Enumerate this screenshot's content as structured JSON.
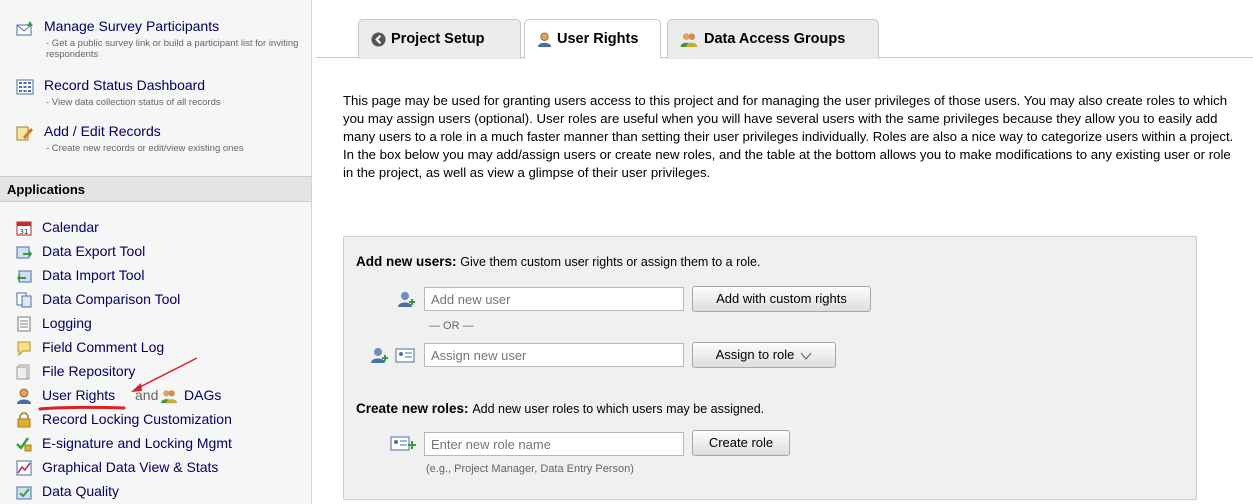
{
  "left_menu": {
    "top_links": [
      {
        "title": "Manage Survey Participants",
        "desc": "- Get a public survey link or build a participant list for inviting respondents",
        "icon": "survey-participants-icon"
      },
      {
        "title": "Record Status Dashboard",
        "desc": "- View data collection status of all records",
        "icon": "dashboard-grid-icon"
      },
      {
        "title": "Add / Edit Records",
        "desc": "- Create new records or edit/view existing ones",
        "icon": "edit-records-icon"
      }
    ],
    "apps_header": "Applications",
    "apps": [
      {
        "label": "Calendar",
        "icon": "calendar-icon"
      },
      {
        "label": "Data Export Tool",
        "icon": "data-export-icon"
      },
      {
        "label": "Data Import Tool",
        "icon": "data-import-icon"
      },
      {
        "label": "Data Comparison Tool",
        "icon": "data-comparison-icon"
      },
      {
        "label": "Logging",
        "icon": "logging-icon"
      },
      {
        "label": "Field Comment Log",
        "icon": "comment-icon"
      },
      {
        "label": "File Repository",
        "icon": "file-repository-icon"
      },
      {
        "label": "User Rights",
        "and": "and",
        "dags": "DAGs",
        "icon": "user-icon"
      },
      {
        "label": "Record Locking Customization",
        "icon": "lock-icon"
      },
      {
        "label": "E-signature and Locking Mgmt",
        "icon": "esignature-icon"
      },
      {
        "label": "Graphical Data View & Stats",
        "icon": "chart-icon"
      },
      {
        "label": "Data Quality",
        "icon": "data-quality-icon"
      }
    ]
  },
  "tabs": [
    {
      "label": "Project Setup",
      "icon": "arrow-circle-icon",
      "active": false
    },
    {
      "label": "User Rights",
      "icon": "user-icon",
      "active": true
    },
    {
      "label": "Data Access Groups",
      "icon": "users-group-icon",
      "active": false
    }
  ],
  "description": "This page may be used for granting users access to this project and for managing the user privileges of those users. You may also create roles to which you may assign users (optional). User roles are useful when you will have several users with the same privileges because they allow you to easily add many users to a role in a much faster manner than setting their user privileges individually. Roles are also a nice way to categorize users within a project. In the box below you may add/assign users or create new roles, and the table at the bottom allows you to make modifications to any existing user or role in the project, as well as view a glimpse of their user privileges.",
  "add_users": {
    "title": "Add new users:",
    "subtitle": "Give them custom user rights or assign them to a role.",
    "add_placeholder": "Add new user",
    "add_button": "Add with custom rights",
    "or_separator": "— OR —",
    "assign_placeholder": "Assign new user",
    "assign_button": "Assign to role"
  },
  "create_roles": {
    "title": "Create new roles:",
    "subtitle": "Add new user roles to which users may be assigned.",
    "placeholder": "Enter new role name",
    "button": "Create role",
    "hint": "(e.g., Project Manager, Data Entry Person)"
  },
  "colors": {
    "link": "#000066",
    "annotation": "#e02020"
  }
}
